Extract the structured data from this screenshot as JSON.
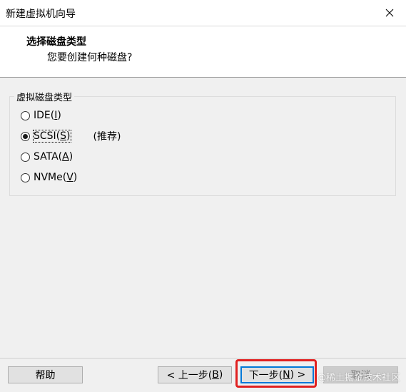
{
  "window": {
    "title": "新建虚拟机向导"
  },
  "header": {
    "title": "选择磁盘类型",
    "subtitle": "您要创建何种磁盘?"
  },
  "group": {
    "label": "虚拟磁盘类型",
    "options": [
      {
        "text": "IDE(",
        "mnemonic": "I",
        "close": ")",
        "selected": false
      },
      {
        "text": "SCSI(",
        "mnemonic": "S",
        "close": ")",
        "selected": true,
        "note": "(推荐)"
      },
      {
        "text": "SATA(",
        "mnemonic": "A",
        "close": ")",
        "selected": false
      },
      {
        "text": "NVMe(",
        "mnemonic": "V",
        "close": ")",
        "selected": false
      }
    ]
  },
  "buttons": {
    "help": "帮助",
    "back": {
      "pre": "< 上一步(",
      "mnemonic": "B",
      "post": ")"
    },
    "next": {
      "pre": "下一步(",
      "mnemonic": "N",
      "post": ") >"
    },
    "cancel": "取消"
  },
  "watermark": "@稀土掘金技术社区",
  "colors": {
    "highlight": "#e02020",
    "default_button_border": "#0078d7"
  }
}
